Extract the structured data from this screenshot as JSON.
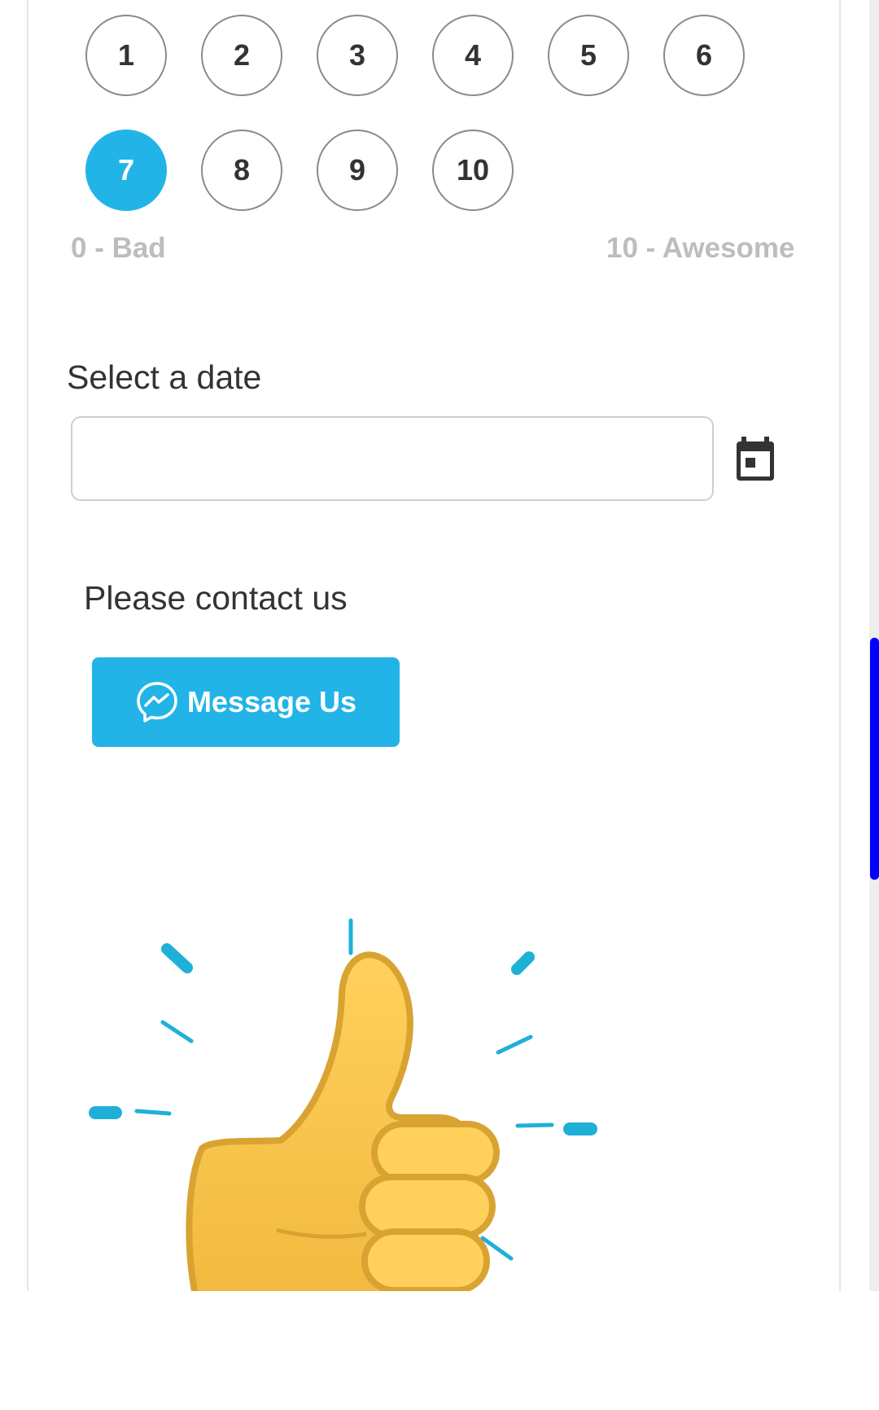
{
  "rating": {
    "options": [
      "1",
      "2",
      "3",
      "4",
      "5",
      "6",
      "7",
      "8",
      "9",
      "10"
    ],
    "selected": "7",
    "min_label": "0 - Bad",
    "max_label": "10 - Awesome"
  },
  "date": {
    "label": "Select a date",
    "value": "",
    "icon": "calendar-icon"
  },
  "contact": {
    "label": "Please contact us",
    "button_label": "Message Us",
    "button_icon": "messenger-icon"
  },
  "image": {
    "icon": "thumbs-up-icon"
  },
  "colors": {
    "accent": "#22b4e7",
    "scrollbar": "#0000ff",
    "muted_text": "#bdbdbd"
  }
}
